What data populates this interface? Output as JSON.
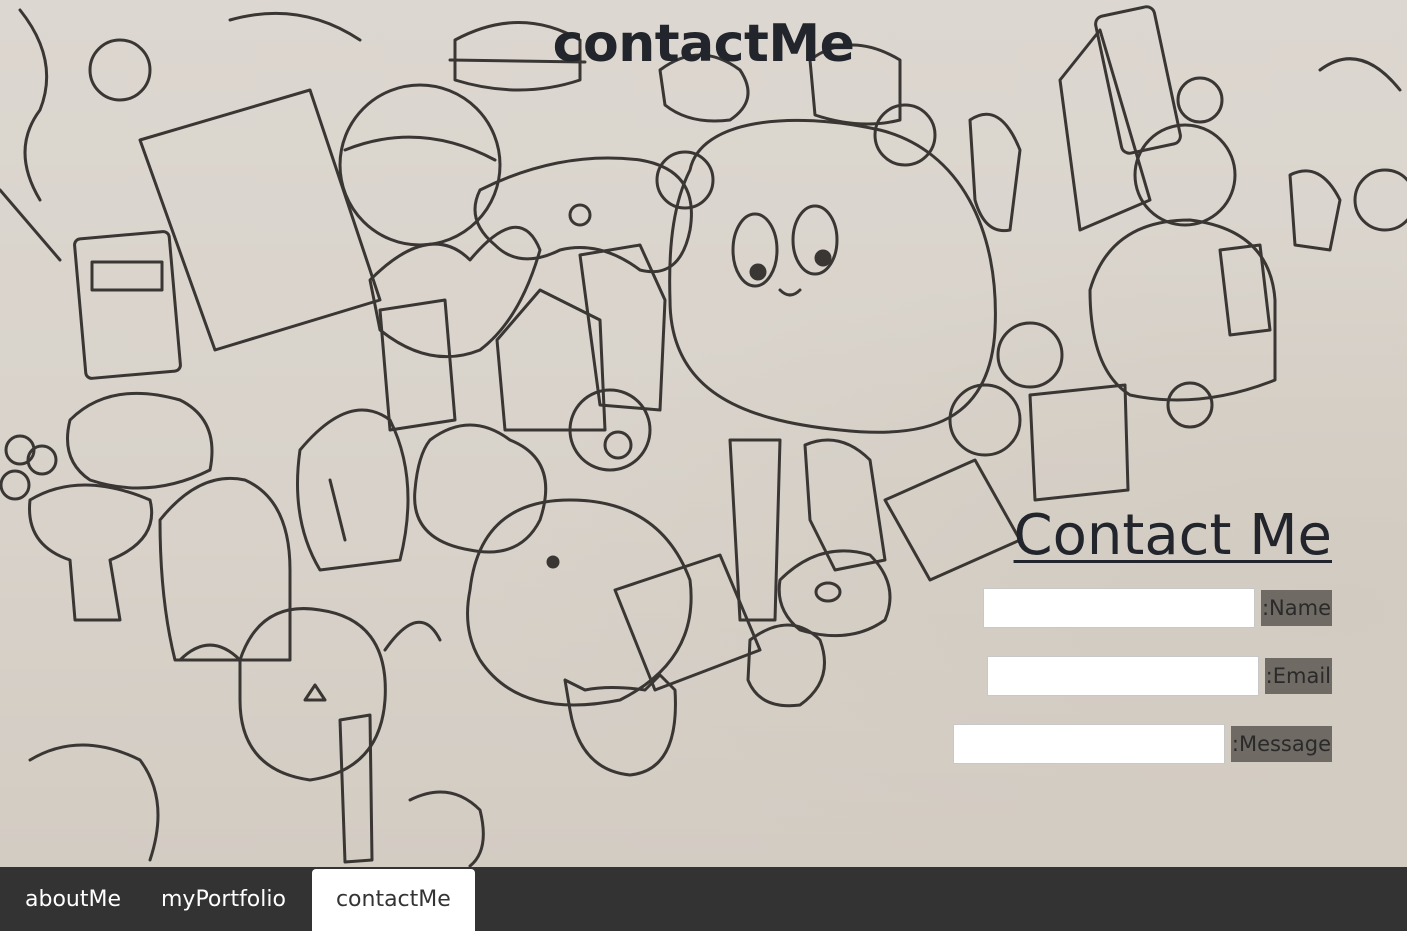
{
  "header": {
    "title": "contactMe"
  },
  "contact": {
    "heading": "Contact Me",
    "fields": [
      {
        "label": ":Name",
        "value": "",
        "placeholder": ""
      },
      {
        "label": ":Email",
        "value": "",
        "placeholder": ""
      },
      {
        "label": ":Message",
        "value": "",
        "placeholder": ""
      }
    ]
  },
  "nav": {
    "tabs": [
      {
        "label": "aboutMe",
        "active": false
      },
      {
        "label": "myPortfolio",
        "active": false
      },
      {
        "label": "contactMe",
        "active": true
      }
    ]
  },
  "colors": {
    "nav_background": "#333333",
    "active_tab": "#ffffff",
    "label_background": "#6f6a63",
    "text_dark": "#22252b"
  }
}
